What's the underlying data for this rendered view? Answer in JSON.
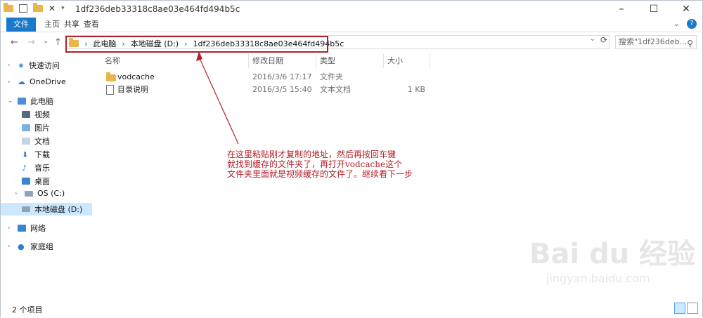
{
  "title": "1df236deb33318c8ae03e464fd494b5c",
  "ribbon": {
    "file": "文件",
    "home": "主页",
    "share": "共享",
    "view": "查看"
  },
  "nav": {
    "back": "←",
    "forward": "→",
    "recent": "⌄",
    "up": "↑",
    "breadcrumbs": [
      "此电脑",
      "本地磁盘 (D:)",
      "1df236deb33318c8ae03e464fd494b5c"
    ],
    "search_placeholder": "搜索\"1df236deb...",
    "refresh": "⟳"
  },
  "sidebar": {
    "items": [
      {
        "label": "快速访问"
      },
      {
        "label": "OneDrive"
      },
      {
        "label": "此电脑"
      },
      {
        "label": "视频"
      },
      {
        "label": "图片"
      },
      {
        "label": "文档"
      },
      {
        "label": "下载"
      },
      {
        "label": "音乐"
      },
      {
        "label": "桌面"
      },
      {
        "label": "OS (C:)"
      },
      {
        "label": "本地磁盘 (D:)"
      },
      {
        "label": "网络"
      },
      {
        "label": "家庭组"
      }
    ]
  },
  "columns": {
    "name": "名称",
    "modified": "修改日期",
    "type": "类型",
    "size": "大小"
  },
  "files": [
    {
      "name": "vodcache",
      "modified": "2016/3/6 17:17",
      "type": "文件夹",
      "size": ""
    },
    {
      "name": "目录说明",
      "modified": "2016/3/5 15:40",
      "type": "文本文档",
      "size": "1 KB"
    }
  ],
  "annotation": [
    "在这里粘贴刚才复制的地址，然后再按回车键",
    "就找到缓存的文件夹了，再打开vodcache这个",
    "文件夹里面就是视频缓存的文件了。继续看下一步"
  ],
  "status": "2 个项目",
  "watermark": {
    "line1": "Bai du 经验",
    "line2": "jingyan.baidu.com"
  },
  "colors": {
    "accent": "#1979ca",
    "annotation": "#b4202a",
    "selected": "#cce8ff",
    "folder": "#e8b64a"
  }
}
